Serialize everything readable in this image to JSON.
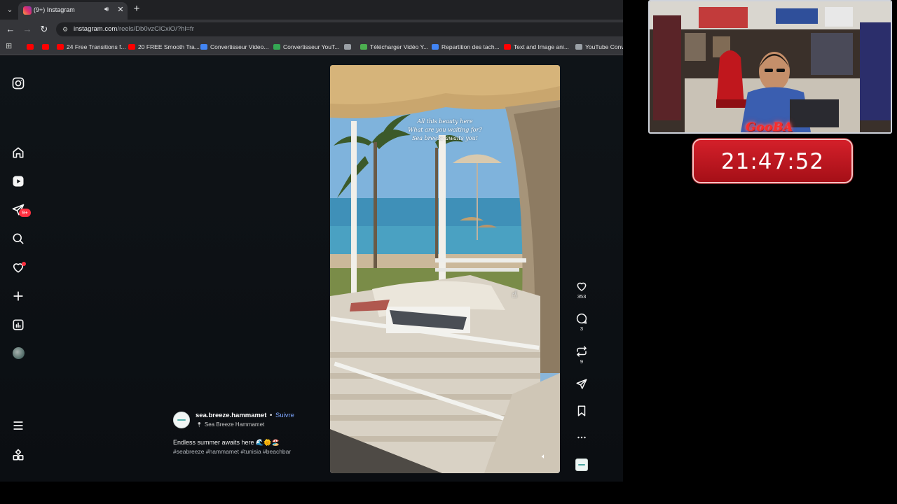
{
  "browser": {
    "tab": {
      "title": "(9+) Instagram"
    },
    "url": {
      "host": "instagram.com",
      "path": "/reels/Db0vzClCxiO/?hl=fr"
    },
    "bookmarks": [
      {
        "label": "",
        "color": "#ff0000"
      },
      {
        "label": "",
        "color": "#ff0000"
      },
      {
        "label": "24 Free Transitions f...",
        "color": "#ff0000"
      },
      {
        "label": "20 FREE Smooth Tra...",
        "color": "#ff0000"
      },
      {
        "label": "Convertisseur Video...",
        "color": "#4285f4"
      },
      {
        "label": "Convertisseur YouT...",
        "color": "#34a853"
      },
      {
        "label": "",
        "color": "#9aa0a6"
      },
      {
        "label": "Télécharger Vidéo Y...",
        "color": "#4caf50"
      },
      {
        "label": "Repartition des tach...",
        "color": "#4285f4"
      },
      {
        "label": "Text and Image ani...",
        "color": "#ff0000"
      },
      {
        "label": "YouTube Conve",
        "color": "#9aa0a6"
      }
    ]
  },
  "sidebar": {
    "items": [
      {
        "name": "instagram-logo-icon"
      },
      {
        "name": "home-icon"
      },
      {
        "name": "reels-icon"
      },
      {
        "name": "messages-icon",
        "badge": "9+"
      },
      {
        "name": "search-icon"
      },
      {
        "name": "notifications-icon"
      },
      {
        "name": "create-icon"
      },
      {
        "name": "dashboard-icon"
      },
      {
        "name": "profile-avatar"
      },
      {
        "name": "menu-icon"
      },
      {
        "name": "also-from-meta-icon"
      }
    ]
  },
  "reel": {
    "overlay_text": [
      "All this beauty here",
      "What are you waiting for?",
      "Sea breeze awaits you!"
    ]
  },
  "actions": {
    "likes": "353",
    "comments": "3",
    "reposts": "9"
  },
  "post": {
    "author": "sea.breeze.hammamet",
    "separator": "•",
    "follow": "Suivre",
    "location": "Sea Breeze Hammamet",
    "caption": "Endless summer awaits here 🌊🌞🏖️",
    "hashtags": "#seabreeze #hammamet #tunisia #beachbar"
  },
  "overlay": {
    "brand": "GooBA",
    "timer": "21:47:52"
  },
  "colors": {
    "accent_follow": "#7ea6ff",
    "notification_red": "#ff3040",
    "timer_red": "#c8161f"
  }
}
